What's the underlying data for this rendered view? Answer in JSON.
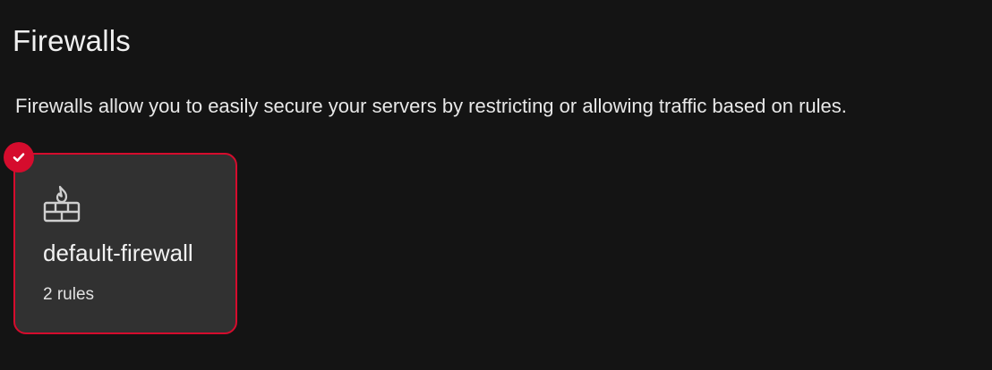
{
  "page": {
    "title": "Firewalls",
    "description": "Firewalls allow you to easily secure your servers by restricting or allowing traffic based on rules."
  },
  "firewalls": [
    {
      "name": "default-firewall",
      "rules": "2 rules",
      "icon": "firewall-icon",
      "selected": true
    }
  ],
  "colors": {
    "background": "#141414",
    "card_background": "#313131",
    "accent": "#d50c2d",
    "text": "#f0f0f0"
  }
}
